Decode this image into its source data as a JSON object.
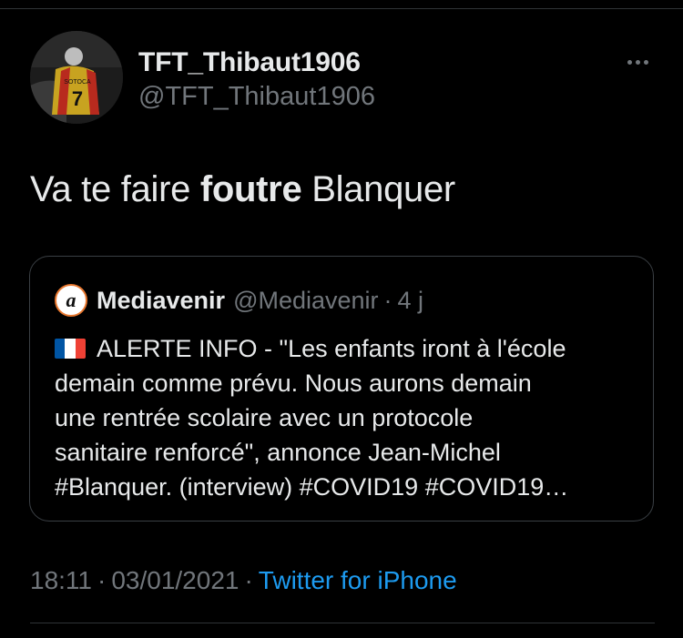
{
  "author": {
    "display_name": "TFT_Thibaut1906",
    "handle": "@TFT_Thibaut1906",
    "jersey_name": "SOTOCA",
    "jersey_number": "7"
  },
  "tweet": {
    "text_before": "Va te faire ",
    "text_bold": "foutre",
    "text_after": " Blanquer"
  },
  "quote": {
    "avatar_letter": "a",
    "name": "Mediavenir",
    "handle": "@Mediavenir",
    "separator": "·",
    "time": "4 j",
    "lines": [
      "ALERTE INFO - \"Les enfants iront à l'école",
      "demain comme prévu. Nous aurons demain",
      "une rentrée scolaire avec un protocole",
      "sanitaire renforcé\", annonce Jean-Michel",
      "#Blanquer. (interview) #COVID19 #COVID19…"
    ]
  },
  "meta": {
    "time": "18:11",
    "separator": "·",
    "date": "03/01/2021",
    "source": "Twitter for iPhone"
  },
  "colors": {
    "background": "#000000",
    "text": "#e7e9ea",
    "secondary": "#71767b",
    "link": "#1d9bf0",
    "border": "#3a3f44",
    "quote_avatar_accent": "#e8772e",
    "flag": [
      "#0055a4",
      "#ffffff",
      "#ef4135"
    ]
  },
  "icons": {
    "more": "more-horizontal-icon",
    "flag": "france-flag-icon"
  }
}
